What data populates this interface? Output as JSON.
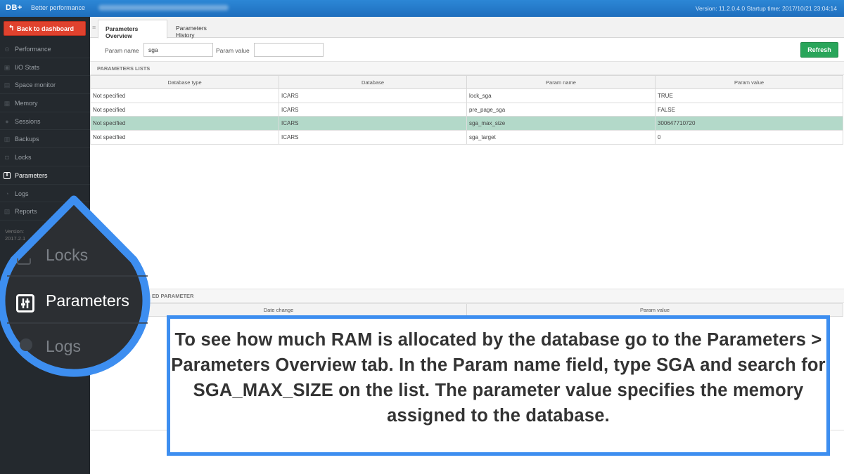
{
  "header": {
    "logo": "DB+",
    "tagline": "Better performance",
    "version_info": "Version: 11.2.0.4.0  Startup time: 2017/10/21 23:04:14"
  },
  "sidebar": {
    "back_button": "Back to dashboard",
    "items": [
      {
        "label": "Performance",
        "icon": "performance-icon"
      },
      {
        "label": "I/O Stats",
        "icon": "io-stats-icon"
      },
      {
        "label": "Space monitor",
        "icon": "space-monitor-icon"
      },
      {
        "label": "Memory",
        "icon": "memory-icon"
      },
      {
        "label": "Sessions",
        "icon": "sessions-icon"
      },
      {
        "label": "Backups",
        "icon": "backups-icon"
      },
      {
        "label": "Locks",
        "icon": "lock-icon"
      },
      {
        "label": "Parameters",
        "icon": "parameters-icon",
        "active": true
      },
      {
        "label": "Logs",
        "icon": "logs-icon"
      },
      {
        "label": "Reports",
        "icon": "reports-icon"
      }
    ],
    "version_label": "Version:",
    "version_value": "2017.2.1"
  },
  "tabs": [
    {
      "label": "Parameters Overview",
      "active": true
    },
    {
      "label": "Parameters History",
      "active": false
    }
  ],
  "filters": {
    "param_name_label": "Param name",
    "param_name_value": "sga",
    "param_value_label": "Param value",
    "param_value_value": ""
  },
  "refresh_button": "Refresh",
  "parameters_list": {
    "title": "PARAMETERS LISTS",
    "columns": [
      "Database type",
      "Database",
      "Param name",
      "Param value"
    ],
    "rows": [
      [
        "Not specified",
        "ICARS",
        "lock_sga",
        "TRUE"
      ],
      [
        "Not specified",
        "ICARS",
        "pre_page_sga",
        "FALSE"
      ],
      [
        "Not specified",
        "ICARS",
        "sga_max_size",
        "300647710720"
      ],
      [
        "Not specified",
        "ICARS",
        "sga_target",
        "0"
      ]
    ],
    "highlighted_row": 2
  },
  "history": {
    "title_partial": "ED PARAMETER",
    "columns": [
      "Date change",
      "Param value"
    ]
  },
  "magnifier": {
    "items": [
      "Locks",
      "Parameters",
      "Logs"
    ]
  },
  "info_box": {
    "text": "To see how much RAM is allocated by the database go to the Parameters > Parameters Overview tab. In the Param name field, type SGA and search for SGA_MAX_SIZE on the list. The parameter value specifies the memory assigned to the database."
  },
  "colors": {
    "topbar": "#2178c8",
    "sidebar": "#24292e",
    "back_button": "#e0422e",
    "refresh_button": "#29a55a",
    "highlight_row": "#b3d9c9",
    "callout_blue": "#3d8ef0"
  }
}
